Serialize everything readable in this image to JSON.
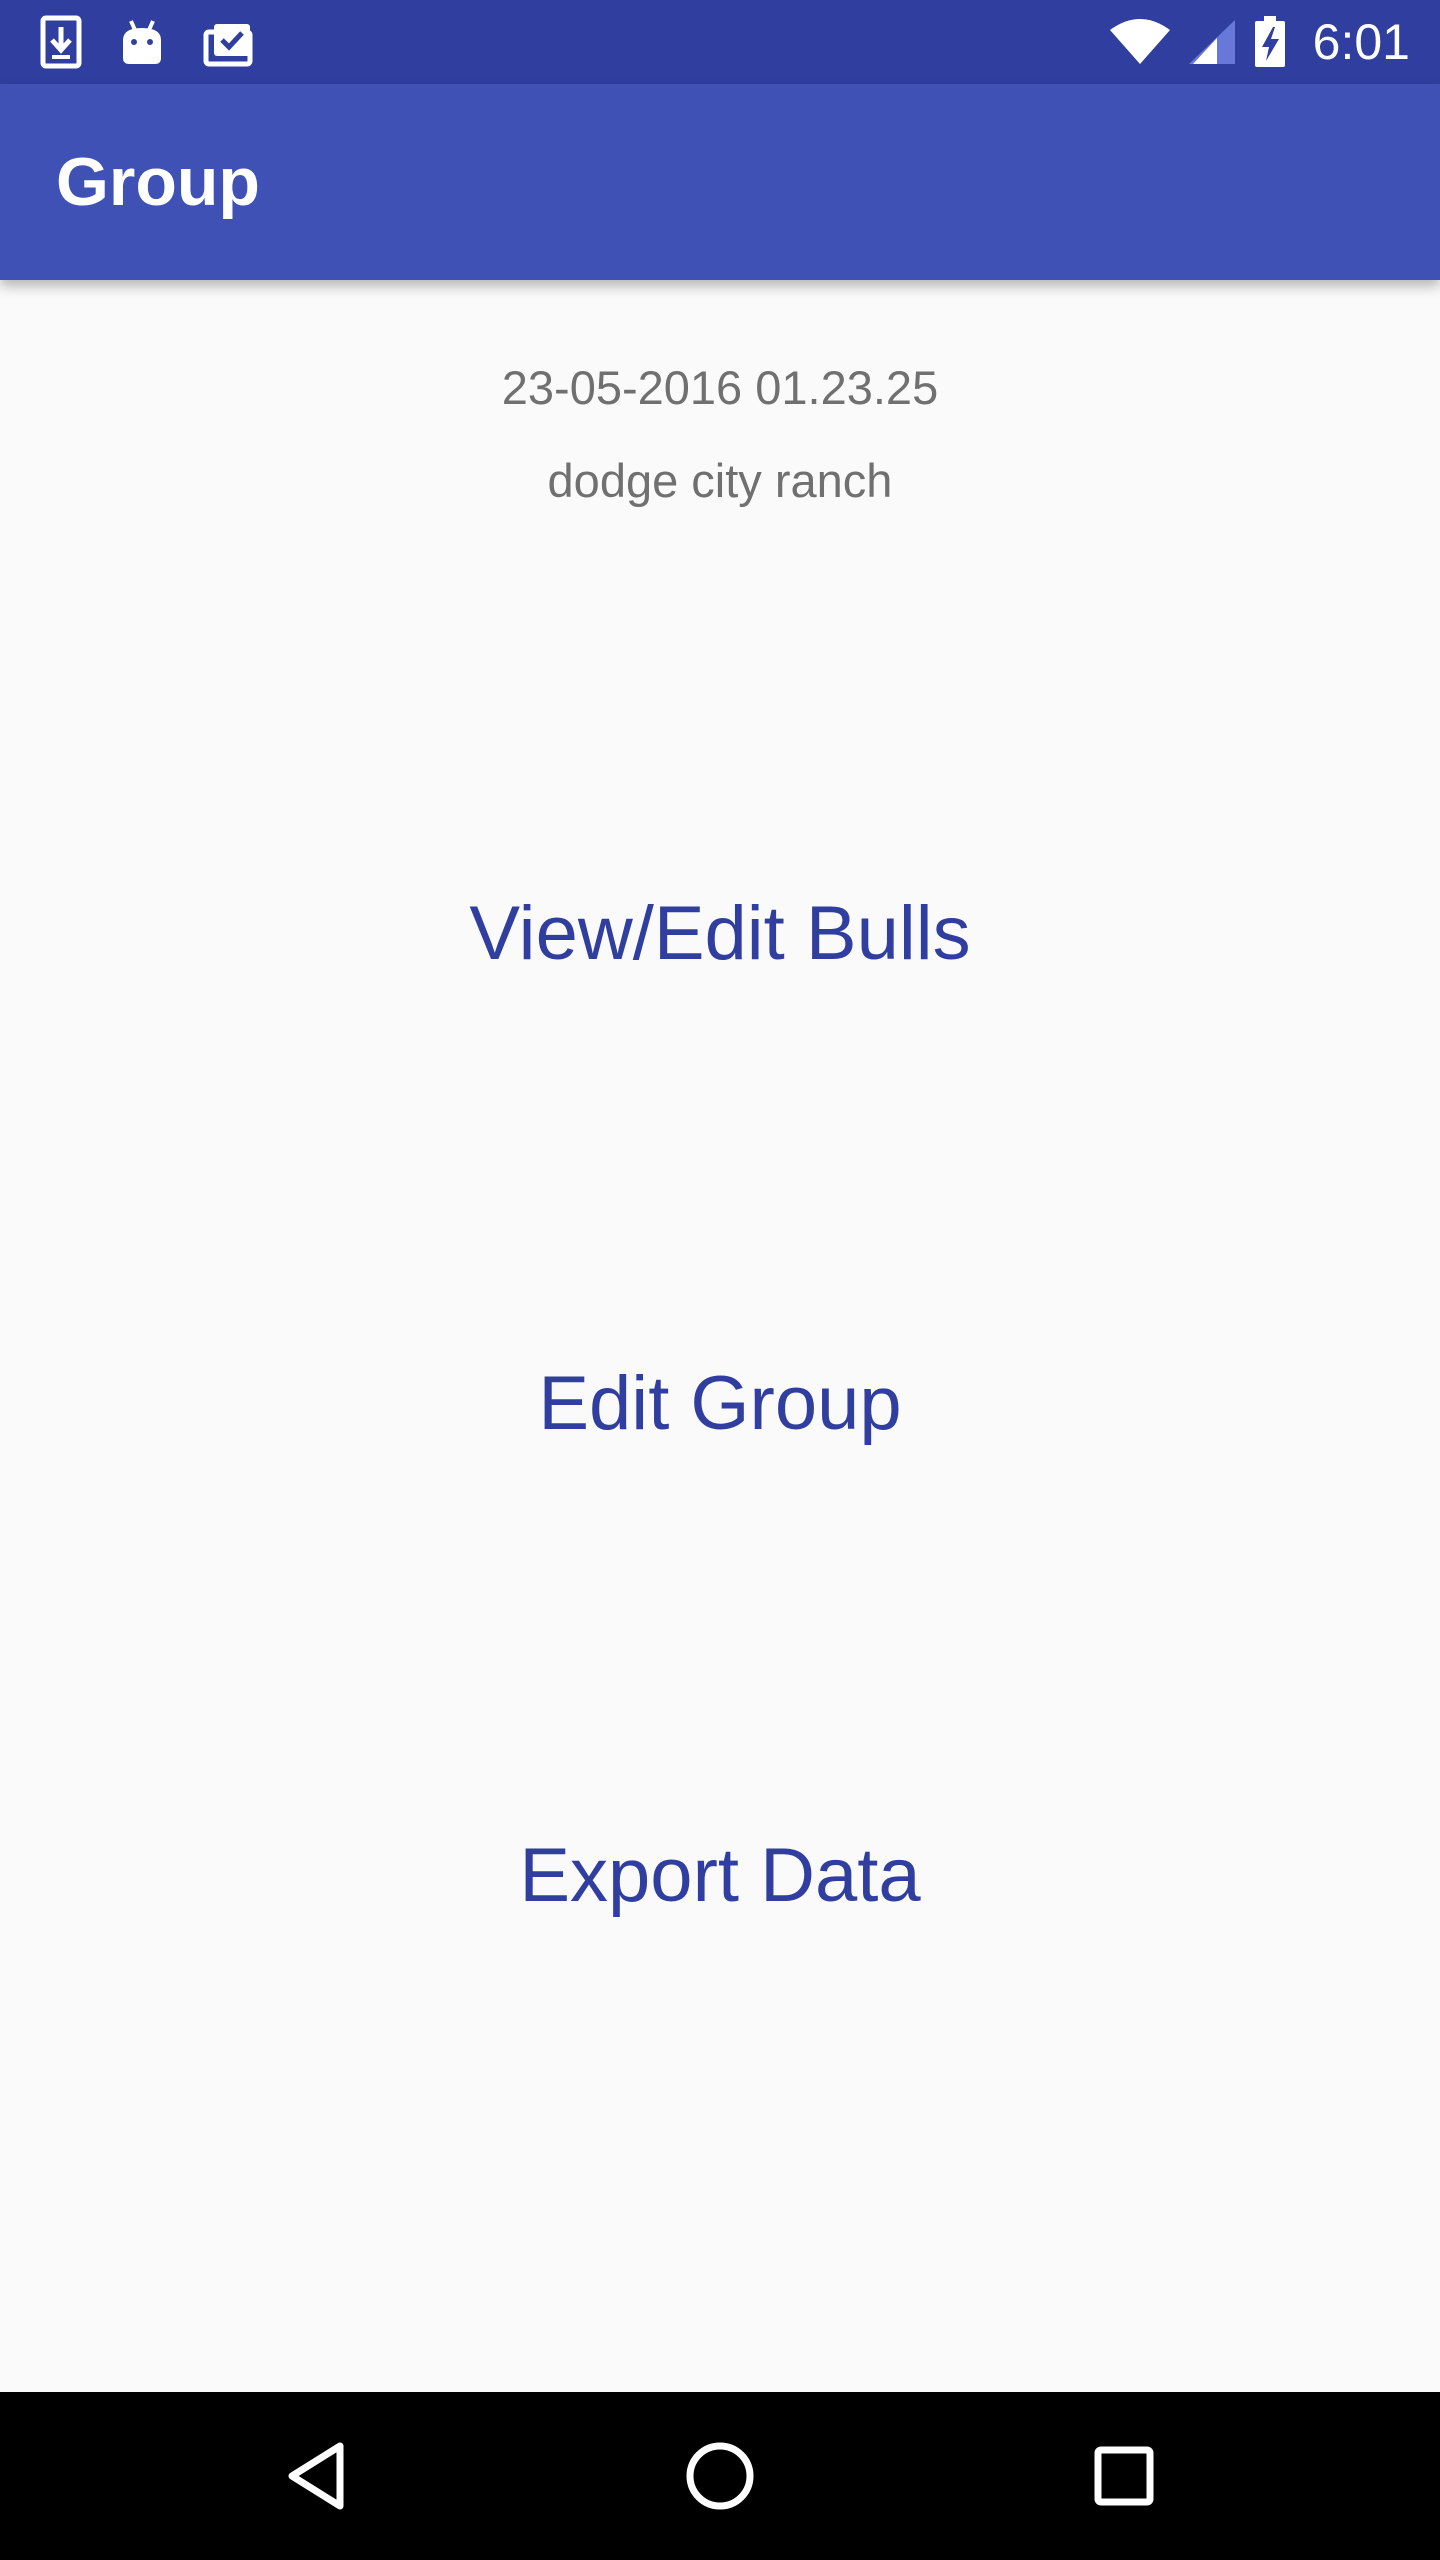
{
  "status_bar": {
    "time": "6:01",
    "left_icons": [
      "download-icon",
      "android-icon",
      "clipboard-check-icon"
    ],
    "right_icons": [
      "wifi-icon",
      "signal-icon",
      "battery-charging-icon"
    ]
  },
  "app_bar": {
    "title": "Group"
  },
  "group": {
    "date": "23-05-2016 01.23.25",
    "ranch": "dodge city ranch"
  },
  "actions": {
    "view_edit_bulls": "View/Edit Bulls",
    "edit_group": "Edit Group",
    "export_data": "Export Data"
  },
  "nav_bar": {
    "icons": [
      "back-icon",
      "home-icon",
      "recents-icon"
    ]
  },
  "colors": {
    "status_bar": "#303f9f",
    "app_bar": "#3f51b5",
    "action_text": "#303f9f",
    "meta_text": "#707070",
    "background": "#fafafa",
    "nav_bar": "#000000"
  }
}
